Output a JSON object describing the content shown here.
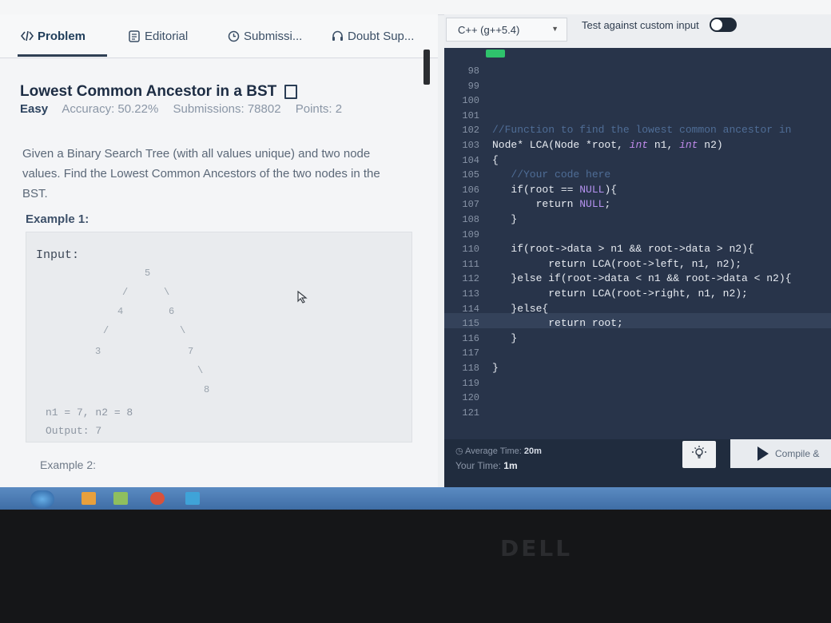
{
  "tabs": [
    {
      "label": "Problem",
      "icon": "code-icon"
    },
    {
      "label": "Editorial",
      "icon": "document-icon"
    },
    {
      "label": "Submissi...",
      "icon": "clock-icon"
    },
    {
      "label": "Doubt Sup...",
      "icon": "headset-icon"
    }
  ],
  "problem": {
    "title": "Lowest Common Ancestor in a BST",
    "difficulty": "Easy",
    "accuracy": "Accuracy: 50.22%",
    "submissions": "Submissions: 78802",
    "points": "Points: 2",
    "description": "Given a Binary Search Tree (with all values unique) and two node values. Find the Lowest Common Ancestors of the two nodes in the BST."
  },
  "example1": {
    "heading": "Example 1:",
    "input_label": "Input:",
    "tree_nodes": [
      "5",
      "4",
      "6",
      "3",
      "7",
      "8"
    ],
    "tree_edges": [
      "/",
      "\\",
      "/",
      "\\",
      "\\"
    ],
    "io_line": "n1 = 7, n2 = 8",
    "output_line": "Output: 7"
  },
  "example2": {
    "heading": "Example 2:"
  },
  "editor": {
    "language": "C++ (g++5.4)",
    "custom_input_label": "Test against custom input",
    "gutter": [
      "98",
      "99",
      "100",
      "101",
      "102",
      "103",
      "104",
      "105",
      "106",
      "107",
      "108",
      "109",
      "110",
      "111",
      "112",
      "113",
      "114",
      "115",
      "116",
      "117",
      "118",
      "119",
      "120",
      "121"
    ],
    "lines": [
      "",
      "",
      "",
      "",
      "//Function to find the lowest common ancestor in",
      "Node* LCA(Node *root, int n1, int n2)",
      "{",
      "   //Your code here",
      "   if(root == NULL){",
      "       return NULL;",
      "   }",
      "",
      "   if(root->data > n1 && root->data > n2){",
      "         return LCA(root->left, n1, n2);",
      "   }else if(root->data < n1 && root->data < n2){",
      "         return LCA(root->right, n1, n2);",
      "   }else{",
      "         return root;",
      "   }",
      "",
      "}",
      "",
      "",
      ""
    ]
  },
  "footer": {
    "avg_label": "Average Time:",
    "avg_value": "20m",
    "your_label": "Your Time:",
    "your_value": "1m",
    "compile_label": "Compile &"
  },
  "brand": {
    "logo": "DELL"
  }
}
